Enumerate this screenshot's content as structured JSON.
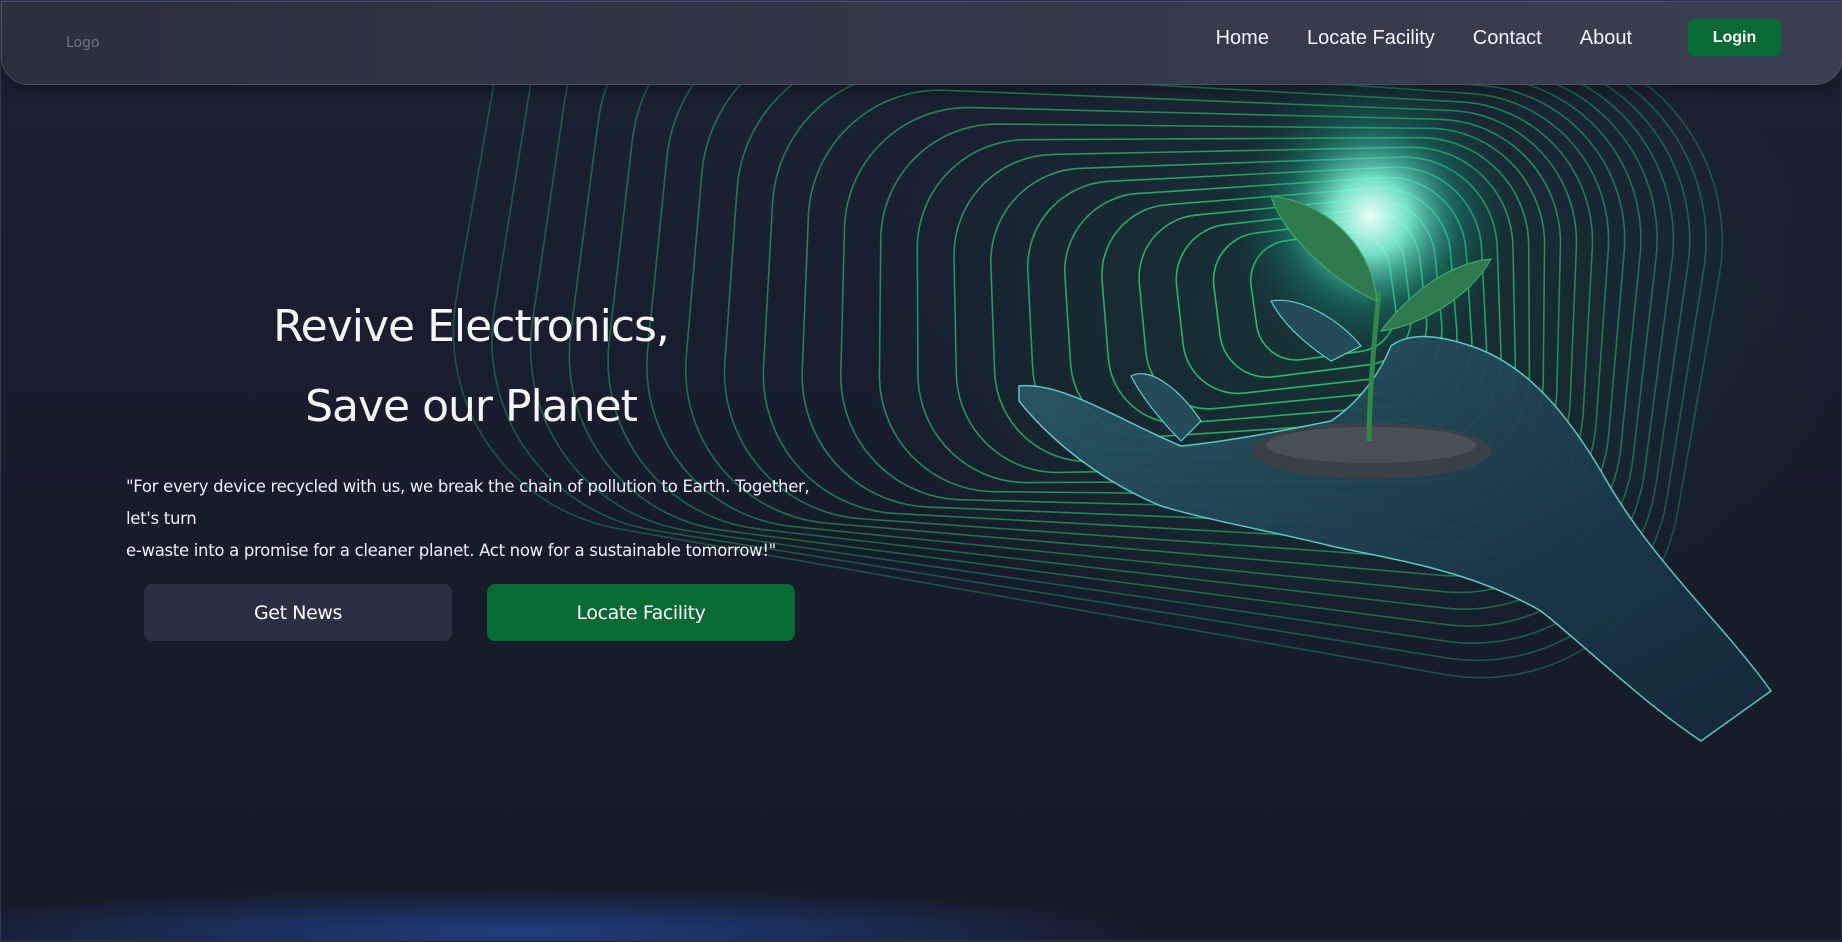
{
  "nav": {
    "logo": "Logo",
    "links": [
      "Home",
      "Locate Facility",
      "Contact",
      "About"
    ],
    "login": "Login"
  },
  "hero": {
    "title_line1": "Revive Electronics,",
    "title_line2": "Save our Planet",
    "quote_line1": "\"For every device recycled with us, we break the chain of pollution to Earth. Together, let's turn",
    "quote_line2": "e-waste into a promise for a cleaner planet. Act now for a sustainable tomorrow!\"",
    "btn_news": "Get News",
    "btn_locate": "Locate Facility"
  },
  "colors": {
    "background": "#171c2b",
    "accent_green": "#0a6a33",
    "secondary_button": "#2a3044",
    "line_green": "#2fd47a"
  },
  "icons": [
    "hand-sprout-illustration"
  ]
}
